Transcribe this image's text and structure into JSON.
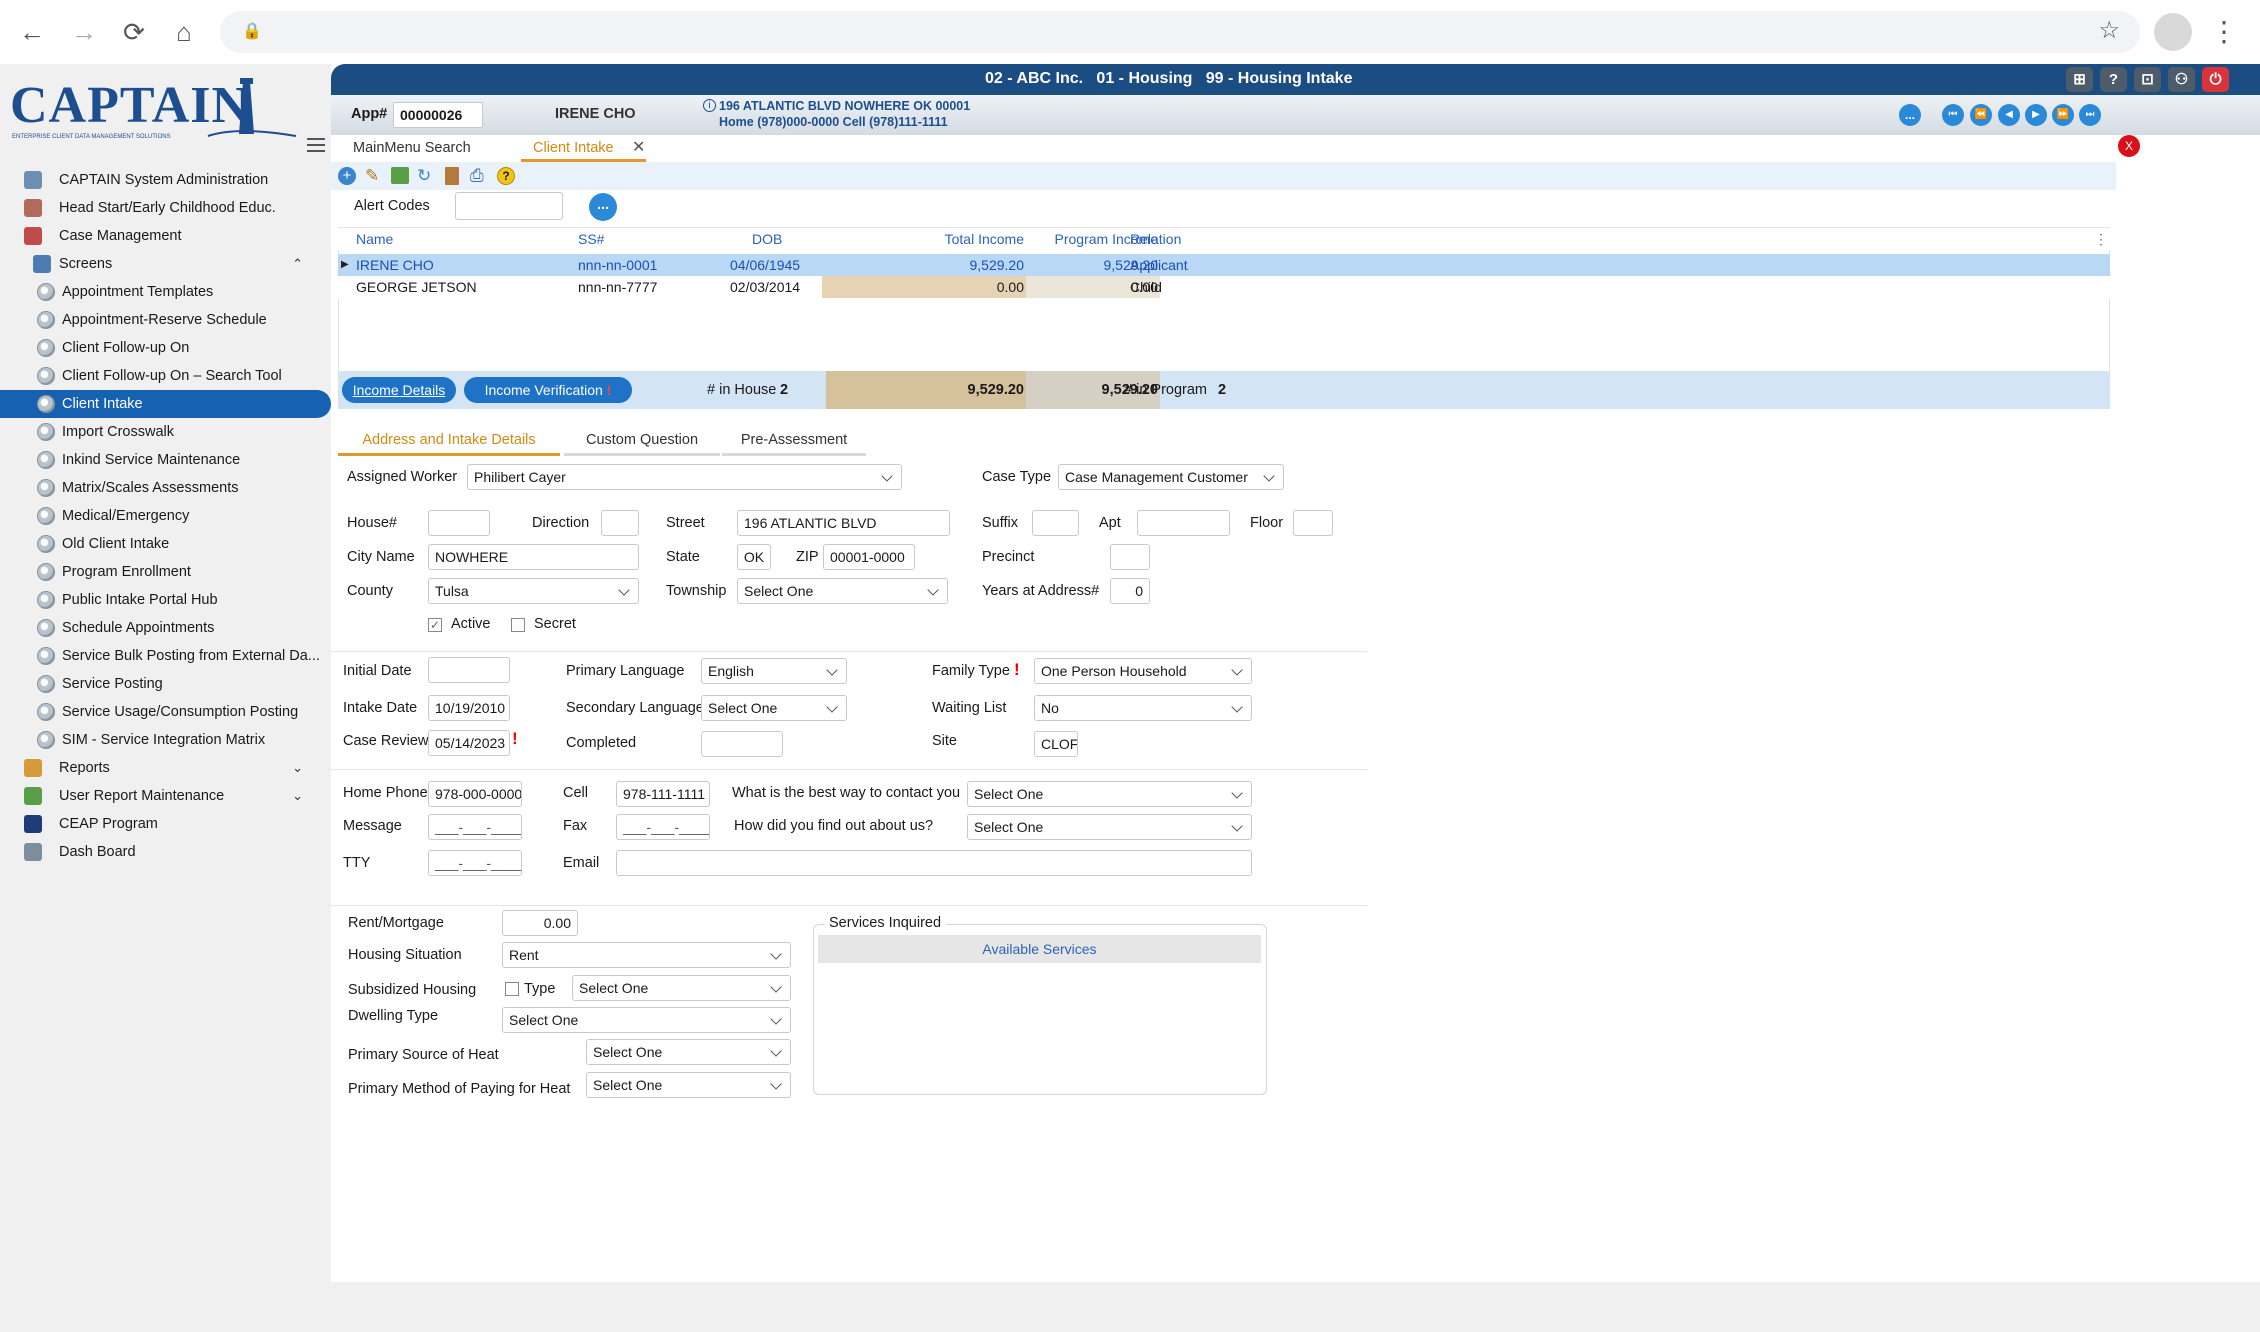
{
  "browser": {
    "back": "←",
    "forward": "→",
    "reload": "⟳",
    "home": "⌂",
    "lock": "🔒",
    "star": "☆",
    "menu": "⋮"
  },
  "brand": {
    "logo": "CAPTAIN",
    "tagline": "ENTERPRISE CLIENT DATA MANAGEMENT SOLUTIONS"
  },
  "header": {
    "context": "02 - ABC Inc.   01 - Housing   99 - Housing Intake"
  },
  "info": {
    "app_label": "App#",
    "app_no": "00000026",
    "client_name": "IRENE CHO",
    "address_line": "196 ATLANTIC BLVD NOWHERE OK 00001",
    "phone_line": "Home (978)000-0000 Cell (978)111-1111",
    "more": "..."
  },
  "tabs": [
    {
      "label": "MainMenu Search"
    },
    {
      "label": "Client Intake"
    }
  ],
  "close_x": "X",
  "sidebar": {
    "items": [
      {
        "label": "CAPTAIN System Administration",
        "level": "top",
        "color": "#6d8fb3"
      },
      {
        "label": "Head Start/Early Childhood Educ.",
        "level": "top",
        "color": "#b06b5b"
      },
      {
        "label": "Case Management",
        "level": "top",
        "color": "#c14b4b"
      },
      {
        "label": "Screens",
        "level": "group",
        "color": "#4d7cb3",
        "chev": "⌃"
      },
      {
        "label": "Appointment Templates",
        "level": "sub"
      },
      {
        "label": "Appointment-Reserve Schedule",
        "level": "sub"
      },
      {
        "label": "Client Follow-up On",
        "level": "sub"
      },
      {
        "label": "Client Follow-up On – Search Tool",
        "level": "sub"
      },
      {
        "label": "Client Intake",
        "level": "sub",
        "active": true
      },
      {
        "label": "Import Crosswalk",
        "level": "sub"
      },
      {
        "label": "Inkind Service Maintenance",
        "level": "sub"
      },
      {
        "label": "Matrix/Scales Assessments",
        "level": "sub"
      },
      {
        "label": "Medical/Emergency",
        "level": "sub"
      },
      {
        "label": "Old Client Intake",
        "level": "sub"
      },
      {
        "label": "Program Enrollment",
        "level": "sub"
      },
      {
        "label": "Public Intake Portal Hub",
        "level": "sub"
      },
      {
        "label": "Schedule Appointments",
        "level": "sub"
      },
      {
        "label": "Service Bulk Posting from External Da...",
        "level": "sub"
      },
      {
        "label": "Service Posting",
        "level": "sub"
      },
      {
        "label": "Service Usage/Consumption Posting",
        "level": "sub"
      },
      {
        "label": "SIM - Service Integration Matrix",
        "level": "sub"
      },
      {
        "label": "Reports",
        "level": "top",
        "color": "#d59b3a",
        "chev": "⌄"
      },
      {
        "label": "User Report Maintenance",
        "level": "top",
        "color": "#5a9e4a",
        "chev": "⌄"
      },
      {
        "label": "CEAP Program",
        "level": "top",
        "color": "#1f3a78"
      },
      {
        "label": "Dash Board",
        "level": "top",
        "color": "#7d8f9e"
      }
    ]
  },
  "alert": {
    "label": "Alert Codes",
    "value": "",
    "more": "..."
  },
  "household": {
    "columns": [
      "Name",
      "SS#",
      "DOB",
      "Total Income",
      "Program Income",
      "Relation"
    ],
    "rows": [
      {
        "name": "IRENE CHO",
        "ssn": "nnn-nn-0001",
        "dob": "04/06/1945",
        "total": "9,529.20",
        "program": "9,529.20",
        "relation": "Applicant"
      },
      {
        "name": "GEORGE JETSON",
        "ssn": "nnn-nn-7777",
        "dob": "02/03/2014",
        "total": "0.00",
        "program": "0.00",
        "relation": "Child"
      }
    ],
    "income_details": "Income Details",
    "income_verification": "Income Verification",
    "in_house_label": "# in House",
    "in_house": "2",
    "sum_total": "9,529.20",
    "sum_program": "9,529.20",
    "in_program_label": "# in Program",
    "in_program": "2"
  },
  "subtabs": [
    {
      "label": "Address and Intake Details"
    },
    {
      "label": "Custom Question"
    },
    {
      "label": "Pre-Assessment"
    }
  ],
  "form": {
    "assigned_worker_label": "Assigned Worker",
    "assigned_worker": "Philibert Cayer",
    "case_type_label": "Case Type",
    "case_type": "Case Management Customer",
    "house_label": "House#",
    "house": "",
    "direction_label": "Direction",
    "direction": "",
    "street_label": "Street",
    "street": "196 ATLANTIC BLVD",
    "suffix_label": "Suffix",
    "suffix": "",
    "apt_label": "Apt",
    "apt": "",
    "floor_label": "Floor",
    "floor": "",
    "city_label": "City Name",
    "city": "NOWHERE",
    "state_label": "State",
    "state": "OK",
    "zip_label": "ZIP",
    "zip": "00001-0000",
    "precinct_label": "Precinct",
    "precinct": "",
    "county_label": "County",
    "county": "Tulsa",
    "township_label": "Township",
    "township": "Select One",
    "years_label": "Years at Address#",
    "years": "0",
    "active_label": "Active",
    "active": true,
    "secret_label": "Secret",
    "secret": false,
    "initial_date_label": "Initial Date",
    "initial_date": "",
    "primary_lang_label": "Primary Language",
    "primary_lang": "English",
    "family_type_label": "Family Type",
    "family_type": "One Person Household",
    "intake_date_label": "Intake Date",
    "intake_date": "10/19/2010",
    "secondary_lang_label": "Secondary Language",
    "secondary_lang": "Select One",
    "waiting_list_label": "Waiting List",
    "waiting_list": "No",
    "case_review_label": "Case Review",
    "case_review": "05/14/2023",
    "completed_label": "Completed",
    "completed": "",
    "site_label": "Site",
    "site": "CLOF",
    "home_phone_label": "Home Phone",
    "home_phone": "978-000-0000",
    "cell_label": "Cell",
    "cell": "978-111-1111",
    "contact_label": "What is the best way to contact you",
    "contact": "Select One",
    "message_label": "Message",
    "message": "___-___-____",
    "fax_label": "Fax",
    "fax": "___-___-____",
    "find_label": "How did you find out about us?",
    "find": "Select One",
    "tty_label": "TTY",
    "tty": "___-___-____",
    "email_label": "Email",
    "email": "",
    "rent_label": "Rent/Mortgage",
    "rent": "0.00",
    "housing_label": "Housing Situation",
    "housing": "Rent",
    "subsidized_label": "Subsidized Housing",
    "type_label": "Type",
    "subsidized_type": "Select One",
    "dwelling_label": "Dwelling Type",
    "dwelling": "Select One",
    "heat_source_label": "Primary Source of Heat",
    "heat_source": "Select One",
    "heat_pay_label": "Primary Method of Paying for Heat",
    "heat_pay": "Select One",
    "services_title": "Services Inquired",
    "available_services": "Available Services"
  }
}
